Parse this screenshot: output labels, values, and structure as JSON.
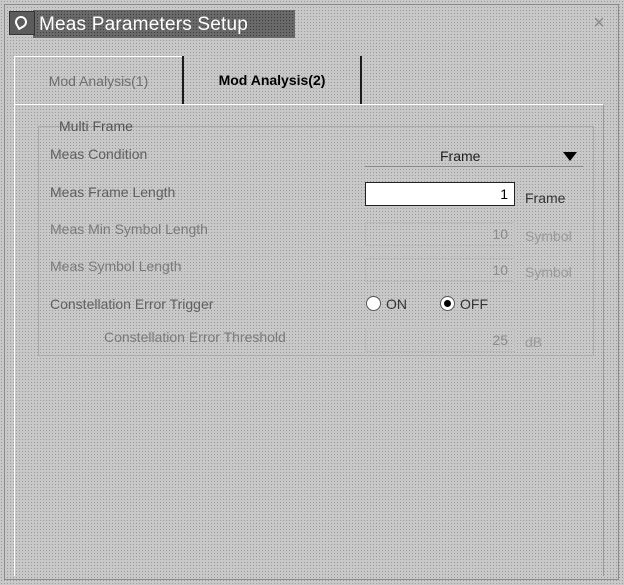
{
  "window": {
    "title": "Meas Parameters Setup",
    "close_glyph": "×"
  },
  "tabs": [
    {
      "label": "Mod Analysis(1)",
      "active": false
    },
    {
      "label": "Mod Analysis(2)",
      "active": true
    }
  ],
  "group": {
    "label": "Multi Frame",
    "meas_condition": {
      "label": "Meas Condition",
      "value": "Frame"
    },
    "frame_length": {
      "label": "Meas Frame Length",
      "value": "1",
      "unit": "Frame"
    },
    "min_symbol_length": {
      "label": "Meas Min Symbol Length",
      "value": "10",
      "unit": "Symbol",
      "enabled": false
    },
    "symbol_length": {
      "label": "Meas Symbol Length",
      "value": "10",
      "unit": "Symbol",
      "enabled": false
    },
    "const_error_trigger": {
      "label": "Constellation Error Trigger",
      "on_label": "ON",
      "off_label": "OFF",
      "selected": "OFF"
    },
    "const_error_threshold": {
      "label": "Constellation Error Threshold",
      "value": "25",
      "unit": "dB",
      "enabled": false
    }
  },
  "icons": {
    "title_icon": "app-logo-icon",
    "dropdown": "chevron-down-icon",
    "close": "close-icon"
  }
}
